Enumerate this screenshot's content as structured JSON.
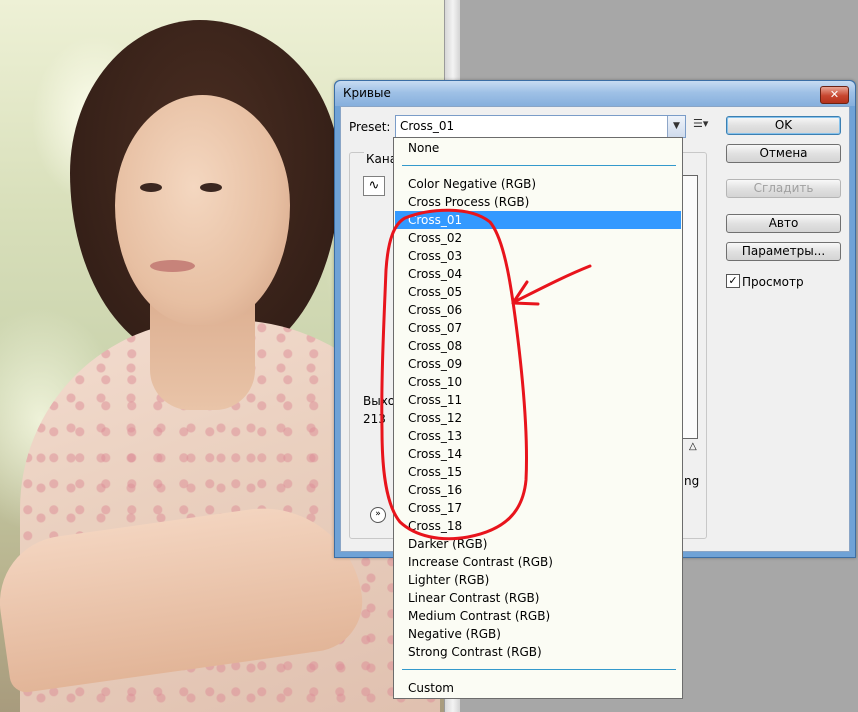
{
  "dialog": {
    "title": "Кривые",
    "preset_label": "Preset:",
    "preset_value": "Cross_01",
    "buttons": {
      "ok": "OK",
      "cancel": "Отмена",
      "smooth": "Сгладить",
      "auto": "Авто",
      "options": "Параметры..."
    },
    "preview_label": "Просмотр",
    "preview_checked": "✓",
    "channel_label": "Канал",
    "output_label": "Выхо",
    "output_value": "213",
    "ng_text": "ng"
  },
  "preset_list": {
    "items": [
      "None",
      "Color Negative (RGB)",
      "Cross Process (RGB)",
      "Cross_01",
      "Cross_02",
      "Cross_03",
      "Cross_04",
      "Cross_05",
      "Cross_06",
      "Cross_07",
      "Cross_08",
      "Cross_09",
      "Cross_10",
      "Cross_11",
      "Cross_12",
      "Cross_13",
      "Cross_14",
      "Cross_15",
      "Cross_16",
      "Cross_17",
      "Cross_18",
      "Darker (RGB)",
      "Increase Contrast (RGB)",
      "Lighter (RGB)",
      "Linear Contrast (RGB)",
      "Medium Contrast (RGB)",
      "Negative (RGB)",
      "Strong Contrast (RGB)",
      "Custom"
    ],
    "selected": "Cross_01"
  },
  "colors": {
    "selection": "#3399ff",
    "annotation": "#e8141c",
    "title_bar": "#9fc1e6"
  },
  "icons": {
    "close": "close-icon",
    "dropdown": "chevron-down-icon",
    "preset_menu": "list-options-icon",
    "curve_tool": "curve-icon",
    "expand": "double-chevron-down-icon"
  }
}
